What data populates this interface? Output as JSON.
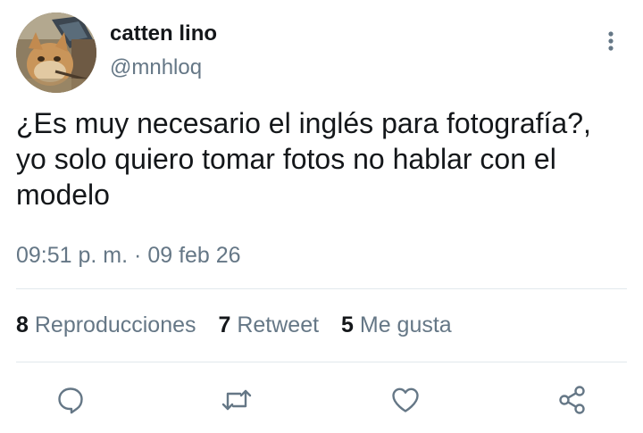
{
  "user": {
    "display_name": "catten lino",
    "handle": "@mnhloq"
  },
  "tweet": {
    "text": "¿Es muy necesario el inglés para fotografía?, yo solo quiero tomar fotos no hablar con el modelo",
    "time": "09:51 p. m.",
    "separator": "·",
    "date": "09 feb 26"
  },
  "stats": [
    {
      "count": "8",
      "label": "Reproducciones"
    },
    {
      "count": "7",
      "label": "Retweet"
    },
    {
      "count": "5",
      "label": "Me gusta"
    }
  ],
  "icons": {
    "more": "more-vertical-icon",
    "reply": "reply-icon",
    "retweet": "retweet-icon",
    "like": "heart-icon",
    "share": "share-icon"
  },
  "colors": {
    "text": "#14171a",
    "secondary": "#657786",
    "divider": "#e1e8ed"
  }
}
